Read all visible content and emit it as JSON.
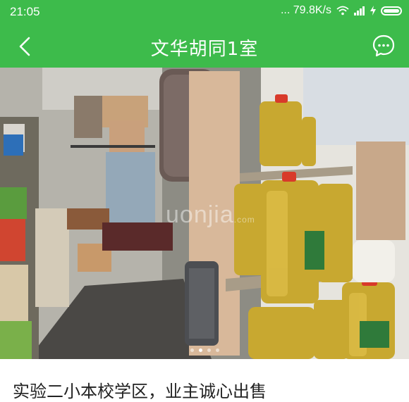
{
  "status_bar": {
    "time": "21:05",
    "network_speed": "... 79.8K/s",
    "icons": [
      "wifi-icon",
      "signal-icon",
      "charging-icon",
      "battery-icon"
    ]
  },
  "nav": {
    "title": "文华胡同1室",
    "back_icon": "chevron-left-icon",
    "chat_icon": "chat-bubble-icon"
  },
  "gallery": {
    "watermark": "uonjia",
    "watermark_sub": ".com",
    "total_images": 4,
    "active_index": 1
  },
  "listing": {
    "title": "实验二小本校学区，业主诚心出售"
  },
  "colors": {
    "brand_green": "#3dbb4b",
    "text_dark": "#222222"
  }
}
